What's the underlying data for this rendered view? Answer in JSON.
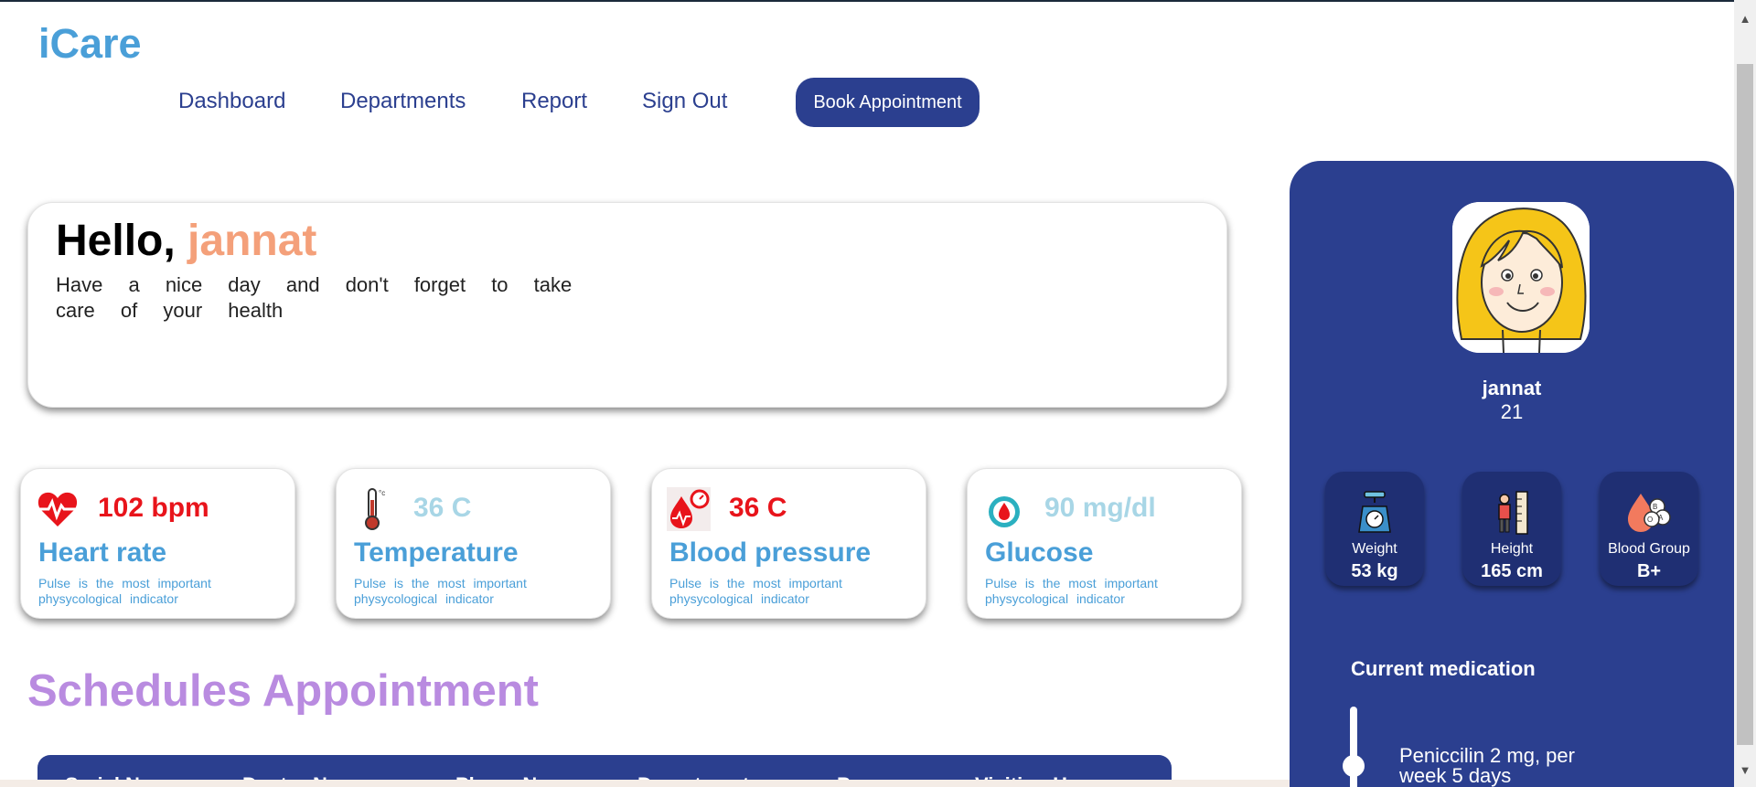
{
  "app": {
    "logo": "iCare"
  },
  "nav": {
    "items": [
      "Dashboard",
      "Departments",
      "Report",
      "Sign Out"
    ],
    "cta": "Book Appointment"
  },
  "greeting": {
    "hello": "Hello, ",
    "name": "jannat",
    "message": "Have a nice day and don't forget to take care of your health"
  },
  "stats": [
    {
      "icon": "heart-rate-icon",
      "value": "102 bpm",
      "title": "Heart rate",
      "desc": "Pulse is the most important physycological indicator",
      "value_color": "#e8141b"
    },
    {
      "icon": "thermometer-icon",
      "value": "36 C",
      "title": "Temperature",
      "desc": "Pulse is the most important physycological indicator",
      "value_color": "#a8d6e6"
    },
    {
      "icon": "blood-pressure-icon",
      "value": "36 C",
      "title": "Blood pressure",
      "desc": "Pulse is the most important physycological indicator",
      "value_color": "#e8141b"
    },
    {
      "icon": "glucose-icon",
      "value": "90 mg/dl",
      "title": "Glucose",
      "desc": "Pulse is the most important physycological indicator",
      "value_color": "#a8d6e6"
    }
  ],
  "schedule": {
    "title": "Schedules Appointment",
    "columns": [
      "Serial No",
      "Doctor Name",
      "Phone No",
      "Department",
      "Purpose",
      "Visiting Hour"
    ]
  },
  "profile": {
    "name": "jannat",
    "age": "21",
    "metrics": [
      {
        "icon": "weight-scale-icon",
        "label": "Weight",
        "value": "53 kg"
      },
      {
        "icon": "height-icon",
        "label": "Height",
        "value": "165 cm"
      },
      {
        "icon": "blood-group-icon",
        "label": "Blood Group",
        "value": "B+"
      }
    ],
    "medication_title": "Current medication",
    "medication": "Peniccilin 2 mg, per week 5 days"
  },
  "colors": {
    "brand": "#2b3f8f",
    "accent": "#4a9fd8",
    "name_accent": "#f4a07a",
    "schedule_title": "#b98be0"
  }
}
